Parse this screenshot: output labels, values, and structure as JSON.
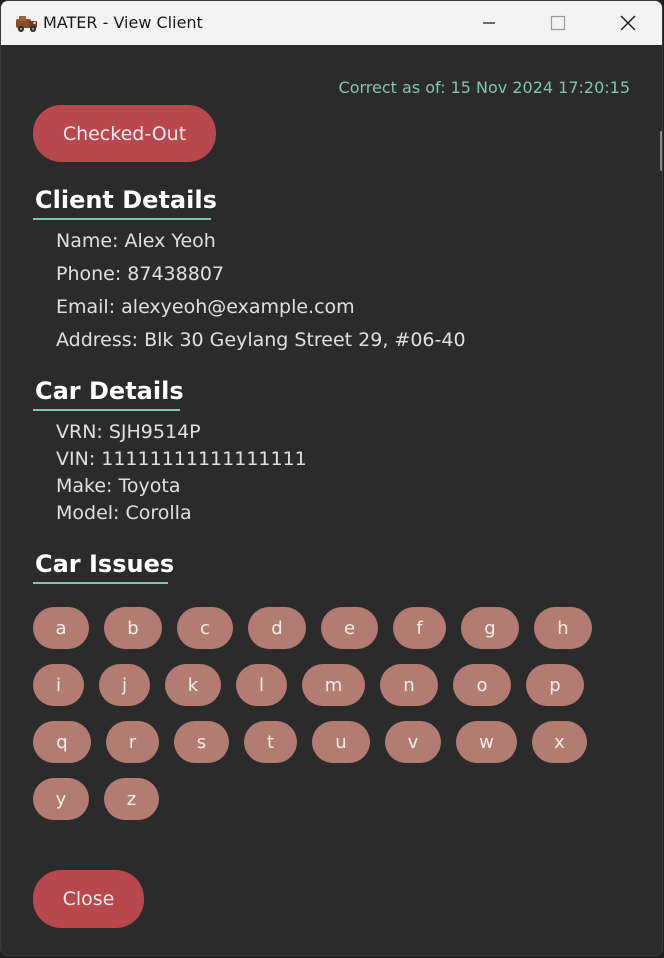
{
  "window": {
    "title": "MATER - View Client"
  },
  "timestamp": "Correct as of: 15 Nov 2024 17:20:15",
  "status_button": "Checked-Out",
  "client_details": {
    "title": "Client Details",
    "name": "Name: Alex Yeoh",
    "phone": "Phone: 87438807",
    "email": "Email: alexyeoh@example.com",
    "address": "Address: Blk 30 Geylang Street 29, #06-40"
  },
  "car_details": {
    "title": "Car Details",
    "vrn": "VRN: SJH9514P",
    "vin": "VIN: 11111111111111111",
    "make": "Make: Toyota",
    "model": "Model: Corolla"
  },
  "car_issues": {
    "title": "Car Issues",
    "tags": [
      "a",
      "b",
      "c",
      "d",
      "e",
      "f",
      "g",
      "h",
      "i",
      "j",
      "k",
      "l",
      "m",
      "n",
      "o",
      "p",
      "q",
      "r",
      "s",
      "t",
      "u",
      "v",
      "w",
      "x",
      "y",
      "z"
    ]
  },
  "close_button": "Close",
  "colors": {
    "accent": "#7fc7b3",
    "danger": "#b8474e",
    "tag": "#b37c73",
    "background": "#2b2b2b"
  },
  "icons": {
    "app": "truck-icon",
    "minimize": "minimize-icon",
    "maximize": "maximize-icon",
    "close": "close-icon"
  }
}
